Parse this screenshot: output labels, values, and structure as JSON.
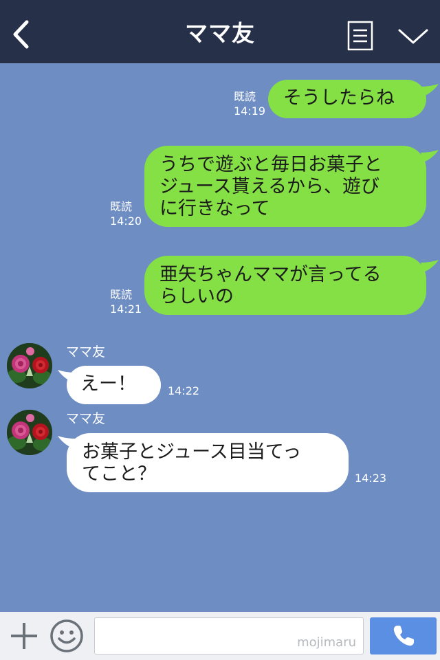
{
  "header": {
    "title": "ママ友"
  },
  "messages": [
    {
      "direction": "out",
      "text": "そうしたらね",
      "read": "既読",
      "time": "14:19"
    },
    {
      "direction": "out",
      "text": "うちで遊ぶと毎日お菓子と\nジュース貰えるから、遊び\nに行きなって",
      "read": "既読",
      "time": "14:20"
    },
    {
      "direction": "out",
      "text": "亜矢ちゃんママが言ってる\nらしいの",
      "read": "既読",
      "time": "14:21"
    },
    {
      "direction": "in",
      "sender": "ママ友",
      "text": "えー！",
      "time": "14:22"
    },
    {
      "direction": "in",
      "sender": "ママ友",
      "text": "お菓子とジュース目当てっ\nてこと？",
      "time": "14:23"
    }
  ],
  "input": {
    "placeholder": "",
    "watermark": "mojimaru"
  },
  "icons": {
    "back": "back-chevron-icon",
    "menu": "menu-list-icon",
    "collapse": "chevron-down-icon",
    "plus": "plus-icon",
    "emoji": "emoji-smile-icon",
    "call": "phone-icon"
  },
  "colors": {
    "header": "#263049",
    "background": "#6e8ec3",
    "outgoing_bubble": "#84e044",
    "incoming_bubble": "#ffffff",
    "call_button": "#5b8fe3"
  }
}
